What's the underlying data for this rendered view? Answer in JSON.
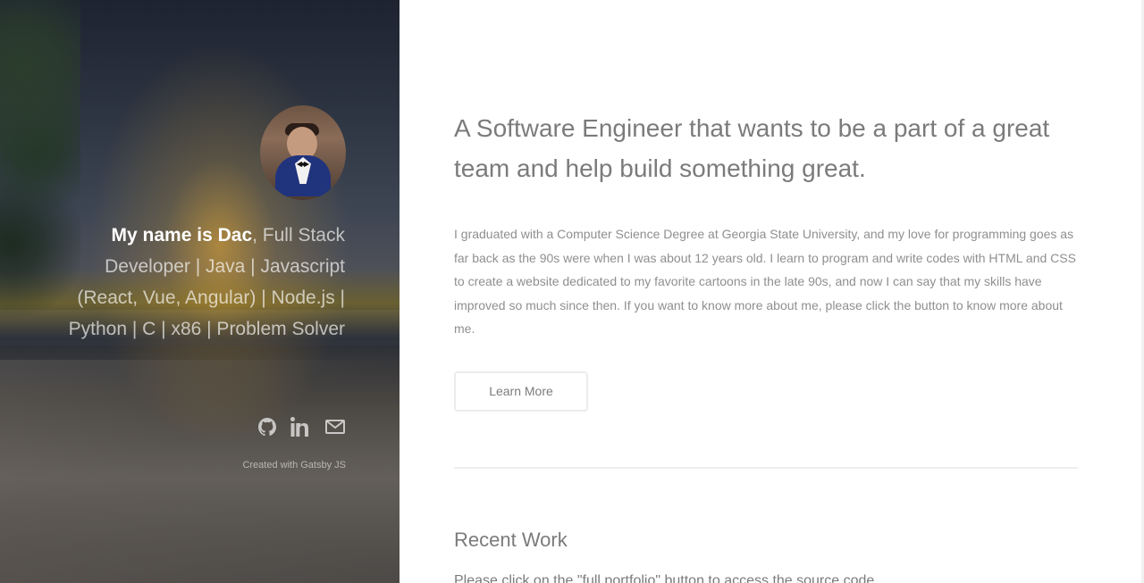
{
  "sidebar": {
    "intro_name": "My name is Dac",
    "intro_rest": ", Full Stack Developer | Java | Javascript (React, Vue, Angular) | Node.js | Python | C | x86 | Problem Solver",
    "social": [
      "github-icon",
      "linkedin-icon",
      "mail-icon"
    ],
    "credit": "Created with Gatsby JS"
  },
  "main": {
    "headline": "A Software Engineer that wants to be a part of a great team and help build something great.",
    "about": "I graduated with a Computer Science Degree at Georgia State University, and my love for programming goes as far back as the 90s were when I was about 12 years old. I learn to program and write codes with HTML and CSS to create a website dedicated to my favorite cartoons in the late 90s, and now I can say that my skills have improved so much since then. If you want to know more about me, please click the button to know more about me.",
    "learn_more": "Learn More",
    "section_title": "Recent Work",
    "section_text": "Please click on the \"full portfolio\" button to access the source code"
  },
  "colors": {
    "heading_gray": "#7b7b7b",
    "body_gray": "#8f8f8f",
    "divider": "#eeeeee",
    "sidebar_text": "#ffffff"
  }
}
